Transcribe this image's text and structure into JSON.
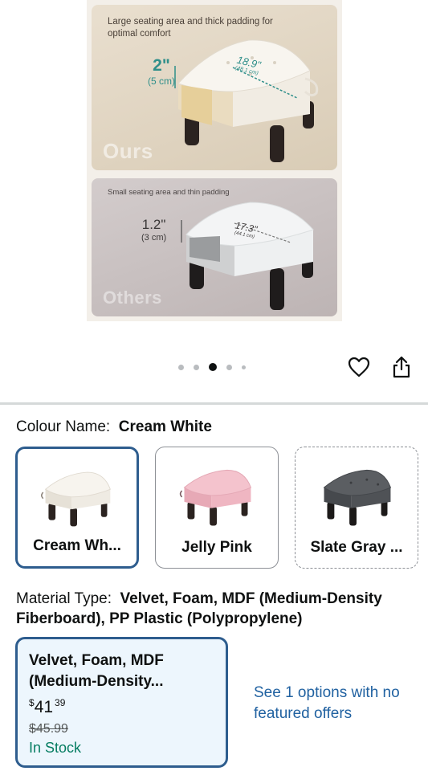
{
  "hero": {
    "ours": {
      "caption": "Large seating area and thick padding for optimal comfort",
      "height_label": "2\"",
      "height_metric": "(5 cm)",
      "width_label": "18.9\"",
      "width_metric": "(48.1 cm)",
      "tag": "Ours"
    },
    "others": {
      "caption": "Small seating area and thin padding",
      "height_label": "1.2\"",
      "height_metric": "(3 cm)",
      "width_label": "17.3\"",
      "width_metric": "(44.1 cm)",
      "tag": "Others"
    }
  },
  "carousel": {
    "dot_count": 5,
    "active_index": 2
  },
  "actions": {
    "favorite_icon": "heart-icon",
    "share_icon": "share-icon"
  },
  "colour": {
    "label": "Colour Name:",
    "selected": "Cream White",
    "options": [
      {
        "name": "Cream Wh...",
        "color": "#f2efe8",
        "state": "selected"
      },
      {
        "name": "Jelly Pink",
        "color": "#f0b8c4",
        "state": "available"
      },
      {
        "name": "Slate Gray ...",
        "color": "#55585c",
        "state": "unavailable"
      }
    ]
  },
  "material": {
    "label": "Material Type:",
    "selected": "Velvet, Foam, MDF (Medium-Density Fiberboard), PP Plastic (Polypropylene)",
    "option": {
      "title": "Velvet, Foam, MDF (Medium-Density...",
      "price_currency": "$",
      "price_whole": "41",
      "price_fraction": "39",
      "list_price": "$45.99",
      "availability": "In Stock"
    },
    "other_offers": "See 1 options with no featured offers"
  },
  "colors": {
    "selected_border": "#2e5d8e",
    "card_bg": "#edf6fd",
    "link": "#2162a1",
    "in_stock": "#067d62"
  }
}
